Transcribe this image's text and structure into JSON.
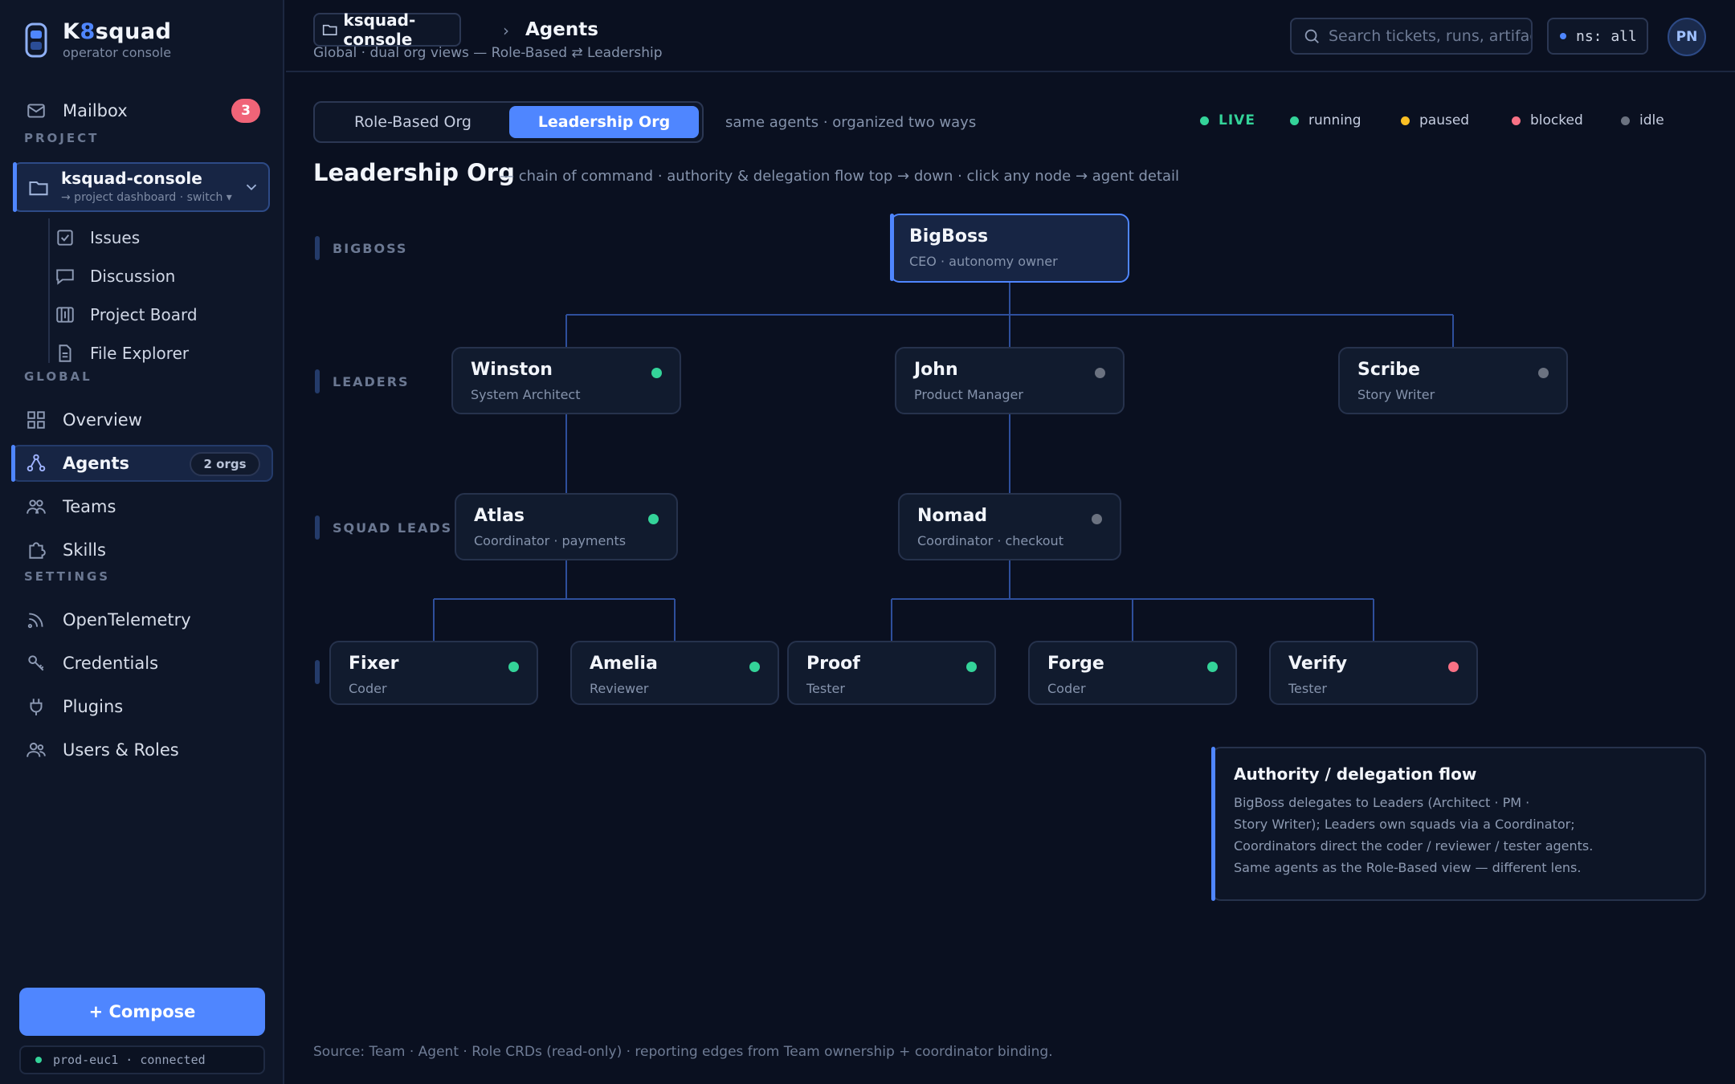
{
  "brand": {
    "name_pre": "K",
    "name_accent": "8",
    "name_post": "squad",
    "subtitle": "operator console"
  },
  "sidebar": {
    "mailbox": {
      "label": "Mailbox",
      "count": "3"
    },
    "section_project": "PROJECT",
    "project": {
      "name": "ksquad-console",
      "sub": "→ project dashboard · switch ▾"
    },
    "project_items": [
      {
        "label": "Issues",
        "icon": "issues-icon"
      },
      {
        "label": "Discussion",
        "icon": "discussion-icon"
      },
      {
        "label": "Project Board",
        "icon": "board-icon"
      },
      {
        "label": "File Explorer",
        "icon": "file-icon"
      }
    ],
    "section_global": "GLOBAL",
    "global_items": [
      {
        "label": "Overview",
        "icon": "grid-icon"
      },
      {
        "label": "Agents",
        "icon": "agents-icon",
        "badge": "2 orgs",
        "active": true
      },
      {
        "label": "Teams",
        "icon": "teams-icon"
      },
      {
        "label": "Skills",
        "icon": "skills-icon"
      }
    ],
    "section_settings": "SETTINGS",
    "settings_items": [
      {
        "label": "OpenTelemetry",
        "icon": "telemetry-icon"
      },
      {
        "label": "Credentials",
        "icon": "key-icon"
      },
      {
        "label": "Plugins",
        "icon": "plug-icon"
      },
      {
        "label": "Users & Roles",
        "icon": "users-icon"
      }
    ],
    "compose_label": "+ Compose",
    "cluster_status": "prod-euc1 · connected"
  },
  "topbar": {
    "project_crumb": "ksquad-console",
    "separator": "›",
    "page": "Agents",
    "subtitle": "Global · dual org views — Role-Based ⇄ Leadership",
    "search_placeholder": "Search tickets, runs, artifacts…",
    "namespace": "ns: all",
    "avatar_initials": "PN"
  },
  "view_toggle": {
    "options": [
      "Role-Based Org",
      "Leadership Org"
    ],
    "selected": "Leadership Org",
    "note": "same agents · organized two ways"
  },
  "legend": {
    "live": "LIVE",
    "items": [
      {
        "label": "running",
        "color": "#34d399"
      },
      {
        "label": "paused",
        "color": "#fbbf24"
      },
      {
        "label": "blocked",
        "color": "#f87185"
      },
      {
        "label": "idle",
        "color": "#6b7280"
      }
    ],
    "live_color": "#34d399"
  },
  "page": {
    "title": "Leadership Org",
    "description": "— chain of command · authority & delegation flow top → down · click any node → agent detail"
  },
  "tiers": [
    "BIGBOSS",
    "LEADERS",
    "SQUAD LEADS",
    ""
  ],
  "org": {
    "root": {
      "name": "BigBoss",
      "role": "CEO · autonomy owner"
    },
    "leaders": [
      {
        "name": "Winston",
        "role": "System Architect",
        "status": "running"
      },
      {
        "name": "John",
        "role": "Product Manager",
        "status": "idle"
      },
      {
        "name": "Scribe",
        "role": "Story Writer",
        "status": "idle"
      }
    ],
    "squad_leads": [
      {
        "name": "Atlas",
        "role": "Coordinator · payments",
        "status": "running"
      },
      {
        "name": "Nomad",
        "role": "Coordinator · checkout",
        "status": "idle"
      }
    ],
    "members": [
      {
        "name": "Fixer",
        "role": "Coder",
        "status": "running"
      },
      {
        "name": "Amelia",
        "role": "Reviewer",
        "status": "running"
      },
      {
        "name": "Proof",
        "role": "Tester",
        "status": "running"
      },
      {
        "name": "Forge",
        "role": "Coder",
        "status": "running"
      },
      {
        "name": "Verify",
        "role": "Tester",
        "status": "blocked"
      }
    ]
  },
  "status_colors": {
    "running": "#34d399",
    "paused": "#fbbf24",
    "blocked": "#f87185",
    "idle": "#6b7280"
  },
  "info": {
    "title": "Authority / delegation flow",
    "lines": [
      "BigBoss delegates to Leaders (Architect · PM ·",
      "Story Writer); Leaders own squads via a Coordinator;",
      "Coordinators direct the coder / reviewer / tester agents.",
      "Same agents as the Role-Based view — different lens."
    ]
  },
  "footer": "Source: Team · Agent · Role CRDs (read-only) · reporting edges from Team ownership + coordinator binding."
}
